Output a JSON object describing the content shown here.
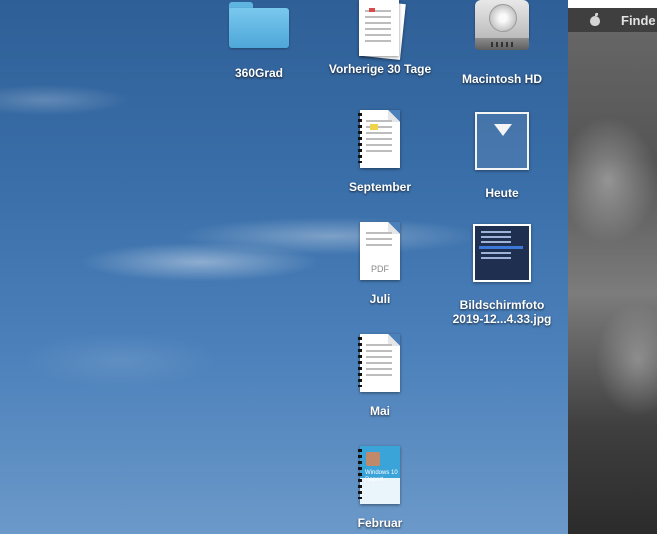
{
  "desktop": {
    "items": [
      {
        "label": "360Grad",
        "icon": "folder-icon"
      },
      {
        "label": "Vorherige 30 Tage",
        "icon": "document-stack-icon"
      },
      {
        "label": "Macintosh HD",
        "icon": "hard-drive-icon"
      },
      {
        "label": "September",
        "icon": "document-icon"
      },
      {
        "label": "Heute",
        "icon": "downloads-frame-icon"
      },
      {
        "label": "Juli",
        "icon": "pdf-document-icon",
        "badge": "PDF"
      },
      {
        "label": "Bildschirmfoto",
        "label2": "2019-12...4.33.jpg",
        "icon": "screenshot-thumbnail-icon"
      },
      {
        "label": "Mai",
        "icon": "document-icon"
      },
      {
        "label": "Februar",
        "icon": "report-document-icon",
        "cover_text": "Windows 10 Report"
      }
    ]
  },
  "menubar": {
    "app_name": "Finde",
    "apple_icon": "apple-icon"
  }
}
